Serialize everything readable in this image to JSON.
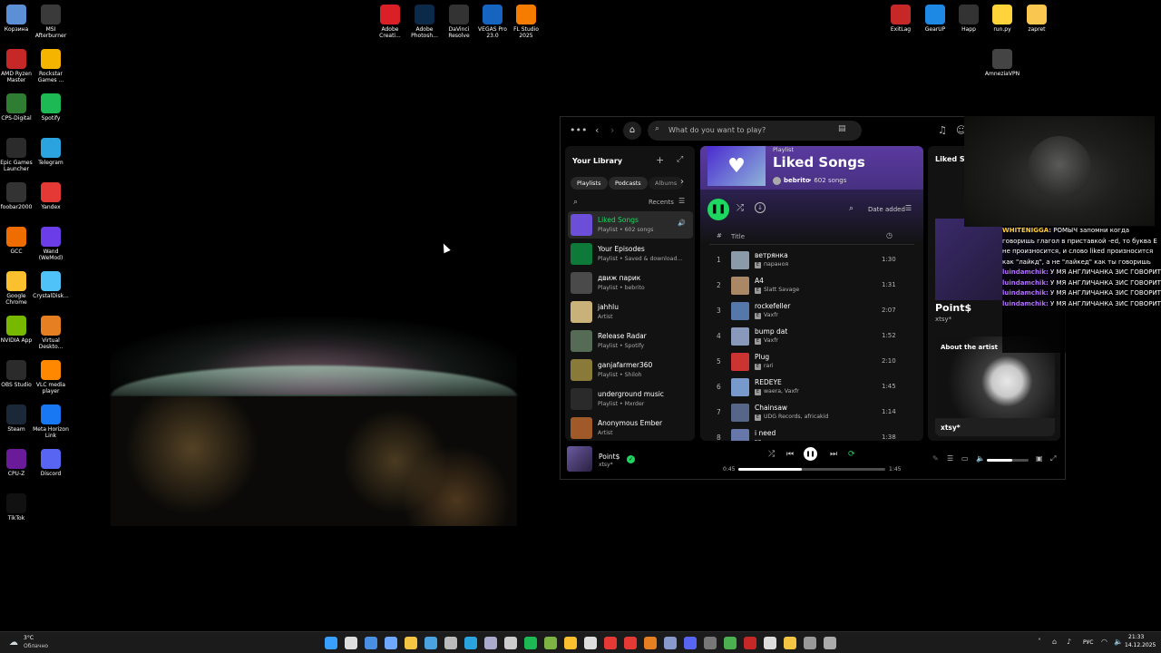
{
  "desktop_icons_left": [
    {
      "label": "Корзина",
      "icon": "recycle-bin-icon",
      "color": "#5b8fd6"
    },
    {
      "label": "MSI Afterburner",
      "icon": "afterburner-icon",
      "color": "#3a3a3a"
    },
    {
      "label": "AMD Ryzen Master",
      "icon": "ryzen-icon",
      "color": "#c62828"
    },
    {
      "label": "Rockstar Games ...",
      "icon": "rockstar-icon",
      "color": "#f4b400"
    },
    {
      "label": "CPS-Digital",
      "icon": "windows-icon",
      "color": "#2e7d32"
    },
    {
      "label": "Spotify",
      "icon": "spotify-icon",
      "color": "#1db954"
    },
    {
      "label": "Epic Games Launcher",
      "icon": "epic-icon",
      "color": "#2b2b2b"
    },
    {
      "label": "Telegram",
      "icon": "telegram-icon",
      "color": "#2aa3df"
    },
    {
      "label": "foobar2000",
      "icon": "foobar-icon",
      "color": "#333"
    },
    {
      "label": "Yandex",
      "icon": "yandex-icon",
      "color": "#e53935"
    },
    {
      "label": "GCC",
      "icon": "gcc-icon",
      "color": "#ef6c00"
    },
    {
      "label": "Wand (WeMod)",
      "icon": "wemod-icon",
      "color": "#6a3de8"
    },
    {
      "label": "Google Chrome",
      "icon": "chrome-icon",
      "color": "#fbc02d"
    },
    {
      "label": "CrystalDisk...",
      "icon": "crystaldisk-icon",
      "color": "#4fc3f7"
    },
    {
      "label": "NVIDIA App",
      "icon": "nvidia-icon",
      "color": "#76b900"
    },
    {
      "label": "Virtual Deskto...",
      "icon": "virtual-desktop-icon",
      "color": "#e67e22"
    },
    {
      "label": "OBS Studio",
      "icon": "obs-icon",
      "color": "#2b2b2b"
    },
    {
      "label": "VLC media player",
      "icon": "vlc-icon",
      "color": "#ff8800"
    },
    {
      "label": "Steam",
      "icon": "steam-icon",
      "color": "#1b2838"
    },
    {
      "label": "Meta Horizon Link",
      "icon": "meta-icon",
      "color": "#1877f2"
    },
    {
      "label": "CPU-Z",
      "icon": "cpuz-icon",
      "color": "#6a1b9a"
    },
    {
      "label": "Discord",
      "icon": "discord-icon",
      "color": "#5865f2"
    },
    {
      "label": "TikTok",
      "icon": "tiktok-icon",
      "color": "#111"
    }
  ],
  "desktop_icons_top": [
    {
      "label": "Adobe Creati...",
      "icon": "creative-cloud-icon",
      "color": "#da1f26"
    },
    {
      "label": "Adobe Photosh...",
      "icon": "photoshop-icon",
      "color": "#0b2a4a"
    },
    {
      "label": "DaVinci Resolve",
      "icon": "davinci-icon",
      "color": "#333"
    },
    {
      "label": "VEGAS Pro 23.0",
      "icon": "vegas-icon",
      "color": "#1565c0"
    },
    {
      "label": "FL Studio 2025",
      "icon": "fl-studio-icon",
      "color": "#f57c00"
    }
  ],
  "desktop_icons_right": [
    {
      "label": "ExitLag",
      "icon": "exitlag-icon",
      "color": "#c62828"
    },
    {
      "label": "GearUP",
      "icon": "gearup-icon",
      "color": "#1e88e5"
    },
    {
      "label": "Happ",
      "icon": "happ-icon",
      "color": "#333"
    },
    {
      "label": "run.py",
      "icon": "python-file-icon",
      "color": "#ffd43b"
    },
    {
      "label": "zapret",
      "icon": "folder-icon",
      "color": "#f9c74f"
    },
    {
      "label": "AmneziaVPN",
      "icon": "amnezia-icon",
      "color": "#444"
    }
  ],
  "spotify": {
    "search_placeholder": "What do you want to play?",
    "library": {
      "title": "Your Library",
      "chips": [
        "Playlists",
        "Podcasts",
        "Albums"
      ],
      "sort": "Recents",
      "items": [
        {
          "title": "Liked Songs",
          "sub": "Playlist • 602 songs",
          "color": "#6b4fd8",
          "active": true
        },
        {
          "title": "Your Episodes",
          "sub": "Playlist • Saved & download...",
          "color": "#0d7a3a"
        },
        {
          "title": "движ парик",
          "sub": "Playlist • bebrito",
          "color": "#4a4a4a"
        },
        {
          "title": "jahhlu",
          "sub": "Artist",
          "color": "#c9b27a"
        },
        {
          "title": "Release Radar",
          "sub": "Playlist • Spotify",
          "color": "#556b55"
        },
        {
          "title": "ganjafarmer360",
          "sub": "Playlist • Shiloh",
          "color": "#8a7a3a"
        },
        {
          "title": "underground music",
          "sub": "Playlist • Mxrder",
          "color": "#2a2a2a"
        },
        {
          "title": "Anonymous Ember",
          "sub": "Artist",
          "color": "#a05a2a"
        }
      ]
    },
    "playlist": {
      "type": "Playlist",
      "title": "Liked Songs",
      "owner": "bebrito",
      "count": "• 602 songs",
      "sort": "Date added",
      "col_hash": "#",
      "col_title": "Title"
    },
    "tracks": [
      {
        "n": "1",
        "title": "ветрянка",
        "artist": "параноя",
        "dur": "1:30",
        "color": "#8a9aa8"
      },
      {
        "n": "2",
        "title": "A4",
        "artist": "Slatt Savage",
        "dur": "1:31",
        "color": "#aa8866"
      },
      {
        "n": "3",
        "title": "rockefeller",
        "artist": "Vaxfr",
        "dur": "2:07",
        "color": "#5577aa"
      },
      {
        "n": "4",
        "title": "bump dat",
        "artist": "Vaxfr",
        "dur": "1:52",
        "color": "#8899bb"
      },
      {
        "n": "5",
        "title": "Plug",
        "artist": "rari",
        "dur": "2:10",
        "color": "#cc3333"
      },
      {
        "n": "6",
        "title": "REDEYE",
        "artist": "waera, Vaxfr",
        "dur": "1:45",
        "color": "#7799cc"
      },
      {
        "n": "7",
        "title": "Chainsaw",
        "artist": "UDG Records, africakid",
        "dur": "1:14",
        "color": "#556688"
      },
      {
        "n": "8",
        "title": "i need",
        "artist": "",
        "dur": "1:38",
        "color": "#6677aa"
      }
    ],
    "right_panel": {
      "header": "Liked So",
      "artist": "Point$",
      "artist_sub": "xtsy*",
      "about": "About the artist",
      "about_name": "xtsy*"
    },
    "now_playing": {
      "title": "Point$",
      "artist": "xtsy*",
      "elapsed": "0:45",
      "total": "1:45",
      "progress": 0.43,
      "volume": 0.6
    }
  },
  "chat": [
    {
      "user": "WHITENIGGA:",
      "msg": "РОМЫЧ запомни когда говоришь глагол в приставкой -ed, то буква Е не произносится, и слово liked произносится как \"лайкд\", а не \"лайкед\" как ты говоришь"
    },
    {
      "user": "luindamchik:",
      "msg": "У МЯ АНГЛИЧАНКА ЗИС ГОВОРИТ"
    },
    {
      "user": "luindamchik:",
      "msg": "У МЯ АНГЛИЧАНКА ЗИС ГОВОРИТ"
    },
    {
      "user": "luindamchik:",
      "msg": "У МЯ АНГЛИЧАНКА ЗИС ГОВОРИТ"
    },
    {
      "user": "luindamchik:",
      "msg": "У МЯ АНГЛИЧАНКА ЗИС ГОВОРИТ"
    }
  ],
  "taskbar": {
    "weather_temp": "3°C",
    "weather_desc": "Облачно",
    "lang": "РУС",
    "time": "21:33",
    "date": "14.12.2025"
  }
}
